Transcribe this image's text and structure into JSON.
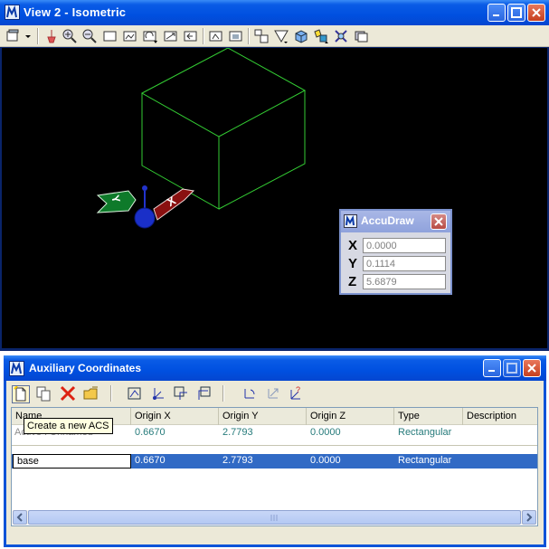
{
  "view_window": {
    "title": "View 2 - Isometric",
    "toolbar_icons": [
      "view-attributes-icon",
      "update-view-icon",
      "zoom-in-icon",
      "zoom-out-icon",
      "window-area-icon",
      "fit-view-icon",
      "rotate-view-icon",
      "pan-view-icon",
      "view-previous-icon",
      "view-next-icon",
      "copy-view-icon",
      "clip-volume-icon",
      "display-style-icon",
      "render-icon",
      "camera-icon",
      "view-settings-icon"
    ]
  },
  "accudraw": {
    "title": "AccuDraw",
    "fields": [
      {
        "label": "X",
        "value": "0.0000"
      },
      {
        "label": "Y",
        "value": "0.1114"
      },
      {
        "label": "Z",
        "value": "5.6879"
      }
    ]
  },
  "triad": {
    "x_label": "X",
    "y_label": "Y"
  },
  "aux_dialog": {
    "title": "Auxiliary Coordinates",
    "tooltip": "Create a new ACS",
    "columns": [
      "Name",
      "Origin X",
      "Origin Y",
      "Origin Z",
      "Type",
      "Description"
    ],
    "active_row": {
      "name": "Active : Unnamed",
      "origin_x": "0.6670",
      "origin_y": "2.7793",
      "origin_z": "0.0000",
      "type": "Rectangular",
      "description": ""
    },
    "rows": [
      {
        "name": "base",
        "origin_x": "0.6670",
        "origin_y": "2.7793",
        "origin_z": "0.0000",
        "type": "Rectangular",
        "description": ""
      }
    ]
  },
  "colors": {
    "titlebar": "#0050e0",
    "viewport": "#000000",
    "cube": "#33cc33",
    "selection": "#316ac5"
  }
}
